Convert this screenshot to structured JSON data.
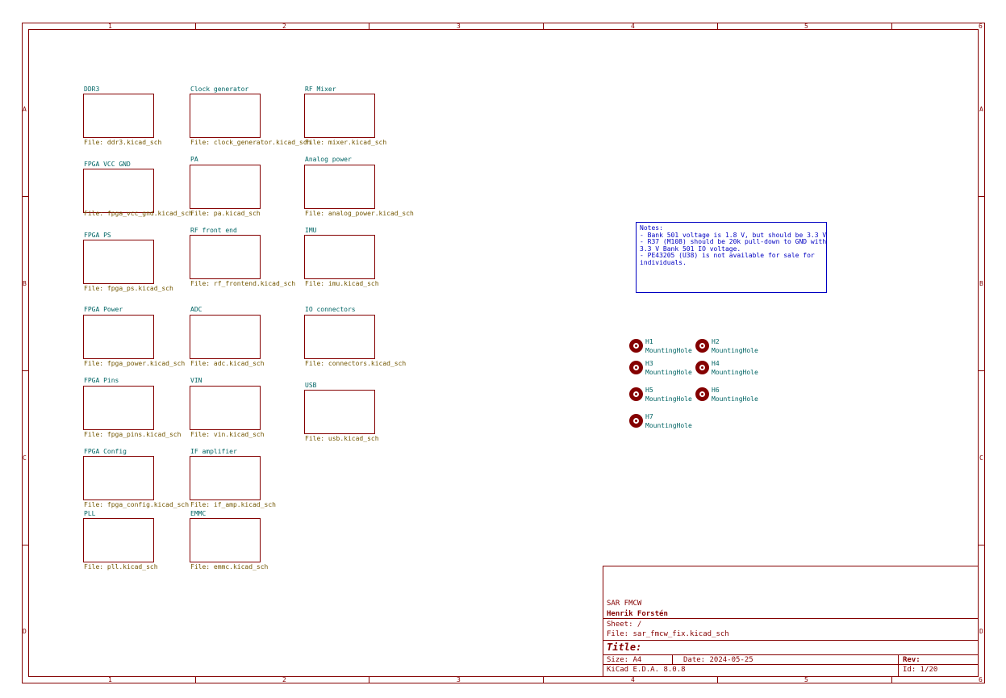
{
  "zones": {
    "columns": [
      "1",
      "2",
      "3",
      "4",
      "5",
      "6"
    ],
    "rows": [
      "A",
      "B",
      "C",
      "D"
    ]
  },
  "sheets": [
    {
      "name": "DDR3",
      "file": "File: ddr3.kicad_sch"
    },
    {
      "name": "Clock generator",
      "file": "File: clock_generator.kicad_sch"
    },
    {
      "name": "RF Mixer",
      "file": "File: mixer.kicad_sch"
    },
    {
      "name": "FPGA VCC GND",
      "file": "File: fpga_vcc_gnd.kicad_sch"
    },
    {
      "name": "PA",
      "file": "File: pa.kicad_sch"
    },
    {
      "name": "Analog power",
      "file": "File: analog_power.kicad_sch"
    },
    {
      "name": "FPGA PS",
      "file": "File: fpga_ps.kicad_sch"
    },
    {
      "name": "RF front end",
      "file": "File: rf_frontend.kicad_sch"
    },
    {
      "name": "IMU",
      "file": "File: imu.kicad_sch"
    },
    {
      "name": "FPGA Power",
      "file": "File: fpga_power.kicad_sch"
    },
    {
      "name": "ADC",
      "file": "File: adc.kicad_sch"
    },
    {
      "name": "IO connectors",
      "file": "File: connectors.kicad_sch"
    },
    {
      "name": "FPGA Pins",
      "file": "File: fpga_pins.kicad_sch"
    },
    {
      "name": "VIN",
      "file": "File: vin.kicad_sch"
    },
    {
      "name": "USB",
      "file": "File: usb.kicad_sch"
    },
    {
      "name": "FPGA Config",
      "file": "File: fpga_config.kicad_sch"
    },
    {
      "name": "IF amplifier",
      "file": "File: if_amp.kicad_sch"
    },
    {
      "name": "PLL",
      "file": "File: pll.kicad_sch"
    },
    {
      "name": "EMMC",
      "file": "File: emmc.kicad_sch"
    }
  ],
  "notes": {
    "text": "Notes:\n- Bank 501 voltage is 1.8 V, but should be 3.3 V\n- R37 (M108) should be 20k pull-down to GND with\n3.3 V Bank 501 IO voltage.\n- PE43205 (U38) is not available for sale for\nindividuals."
  },
  "mounting_holes": [
    {
      "ref": "H1",
      "value": "MountingHole"
    },
    {
      "ref": "H2",
      "value": "MountingHole"
    },
    {
      "ref": "H3",
      "value": "MountingHole"
    },
    {
      "ref": "H4",
      "value": "MountingHole"
    },
    {
      "ref": "H5",
      "value": "MountingHole"
    },
    {
      "ref": "H6",
      "value": "MountingHole"
    },
    {
      "ref": "H7",
      "value": "MountingHole"
    }
  ],
  "title_block": {
    "company": "SAR FMCW",
    "author": "Henrik Forstén",
    "sheet": "Sheet: /",
    "file": "File: sar_fmcw_fix.kicad_sch",
    "title_label": "Title:",
    "size": "Size: A4",
    "date": "Date: 2024-05-25",
    "rev": "Rev:",
    "tool": "KiCad E.D.A. 8.0.8",
    "id": "Id: 1/20"
  },
  "colors": {
    "frame": "#840000",
    "sheet_name": "#006464",
    "sheet_file": "#725600",
    "notes": "#0000c2"
  }
}
